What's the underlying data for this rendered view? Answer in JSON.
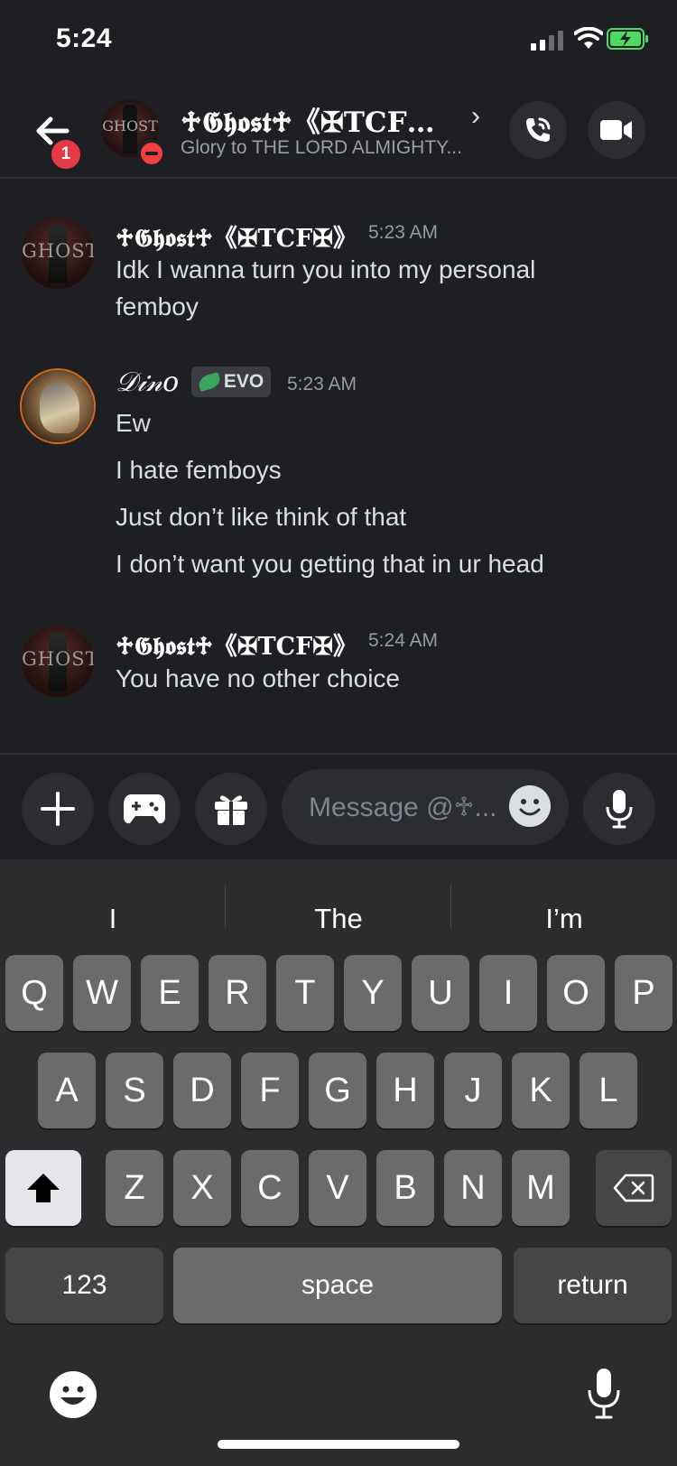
{
  "status_bar": {
    "time": "5:24"
  },
  "header": {
    "back_badge_count": "1",
    "title": "♱𝕲𝖍𝖔𝖘𝖙♱《✠TCF…",
    "status": "Glory to THE LORD ALMIGHTY...",
    "icons": {
      "back": "back-arrow-icon",
      "call": "phone-call-icon",
      "video": "video-camera-icon",
      "presence": "do-not-disturb-icon"
    }
  },
  "messages": [
    {
      "author": "♱𝕲𝖍𝖔𝖘𝖙♱《✠TCF✠》",
      "time": "5:23 AM",
      "avatar_text": "GHOST",
      "lines": [
        "Idk I wanna turn you into my personal",
        "femboy"
      ]
    },
    {
      "author": "𝒟𝒾𝓃𝑜",
      "badge": "EVO",
      "time": "5:23 AM",
      "lines": [
        "Ew",
        "I hate femboys",
        "Just don’t like think of that",
        "I don’t want you getting that in ur head"
      ]
    },
    {
      "author": "♱𝕲𝖍𝖔𝖘𝖙♱《✠TCF✠》",
      "time": "5:24 AM",
      "avatar_text": "GHOST",
      "lines": [
        "You have no other choice"
      ]
    }
  ],
  "composer": {
    "placeholder": "Message @♱...",
    "icons": {
      "add": "plus-icon",
      "games": "gamepad-icon",
      "gift": "gift-icon",
      "emoji": "smiley-icon",
      "mic": "microphone-icon"
    }
  },
  "keyboard": {
    "suggestions": [
      "I",
      "The",
      "I’m"
    ],
    "row1": [
      "Q",
      "W",
      "E",
      "R",
      "T",
      "Y",
      "U",
      "I",
      "O",
      "P"
    ],
    "row2": [
      "A",
      "S",
      "D",
      "F",
      "G",
      "H",
      "J",
      "K",
      "L"
    ],
    "row3": [
      "Z",
      "X",
      "C",
      "V",
      "B",
      "N",
      "M"
    ],
    "numbers_label": "123",
    "space_label": "space",
    "return_label": "return"
  }
}
